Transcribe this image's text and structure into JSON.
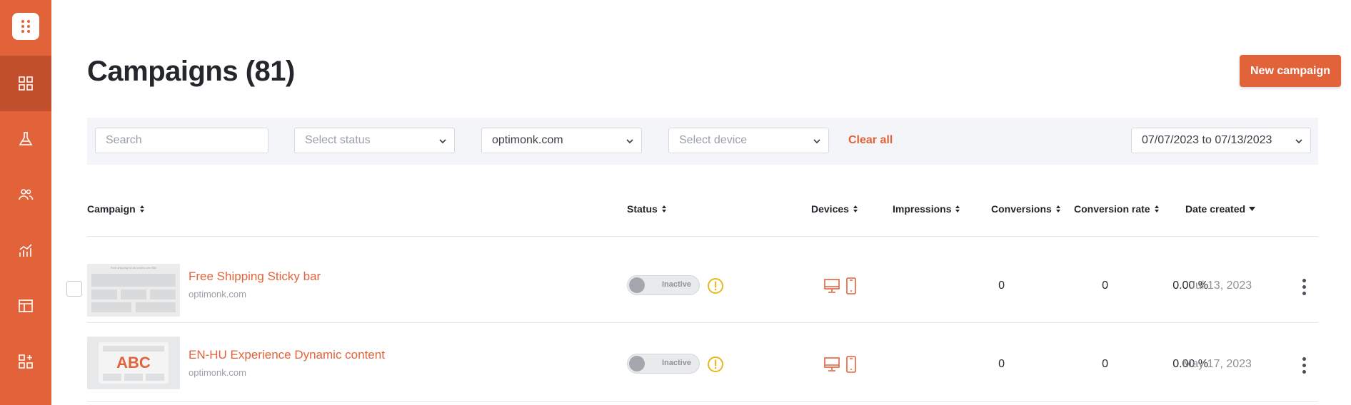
{
  "page": {
    "title": "Campaigns (81)",
    "new_campaign_label": "New campaign"
  },
  "sidebar": {
    "items": [
      {
        "icon": "dashboard-icon"
      },
      {
        "icon": "flask-icon"
      },
      {
        "icon": "users-icon"
      },
      {
        "icon": "analytics-icon"
      },
      {
        "icon": "layout-icon"
      },
      {
        "icon": "add-widget-icon"
      }
    ]
  },
  "filters": {
    "search_placeholder": "Search",
    "status_placeholder": "Select status",
    "domain_value": "optimonk.com",
    "device_placeholder": "Select device",
    "clear_all": "Clear all",
    "date_range": "07/07/2023 to 07/13/2023"
  },
  "table": {
    "headers": {
      "campaign": "Campaign",
      "status": "Status",
      "devices": "Devices",
      "impressions": "Impressions",
      "conversions": "Conversions",
      "conversion_rate": "Conversion rate",
      "date_created": "Date created"
    },
    "rows": [
      {
        "name": "Free Shipping Sticky bar",
        "domain": "optimonk.com",
        "thumb_text": "Free shipping for all orders over $50",
        "status": "Inactive",
        "impressions": "0",
        "conversions": "0",
        "conversion_rate": "0.00 %",
        "date_created": "Jul 13, 2023"
      },
      {
        "name": "EN-HU Experience Dynamic content",
        "domain": "optimonk.com",
        "thumb_text": "ABC",
        "status": "Inactive",
        "impressions": "0",
        "conversions": "0",
        "conversion_rate": "0.00 %",
        "date_created": "May 17, 2023"
      }
    ]
  },
  "colors": {
    "accent": "#e2623a",
    "accent_dark": "#c24f2c",
    "warning": "#e8b81c"
  }
}
